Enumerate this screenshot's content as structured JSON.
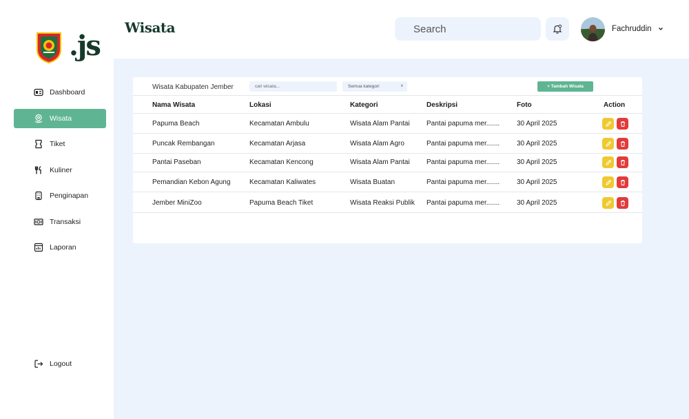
{
  "sidebar": {
    "items": [
      {
        "label": "Dashboard",
        "icon": "dashboard-icon",
        "active": false
      },
      {
        "label": "Wisata",
        "icon": "location-pin-icon",
        "active": true
      },
      {
        "label": "Tiket",
        "icon": "ticket-icon",
        "active": false
      },
      {
        "label": "Kuliner",
        "icon": "utensils-icon",
        "active": false
      },
      {
        "label": "Penginapan",
        "icon": "building-icon",
        "active": false
      },
      {
        "label": "Transaksi",
        "icon": "cash-icon",
        "active": false
      },
      {
        "label": "Laporan",
        "icon": "report-icon",
        "active": false
      }
    ],
    "logout_label": "Logout"
  },
  "header": {
    "title": "Wisata",
    "search_placeholder": "Search",
    "user_name": "Fachruddin"
  },
  "card": {
    "title": "Wisata Kabupaten Jember",
    "search_placeholder": "cari wisata...",
    "category_select": "Semua kategori",
    "category_caret": "v",
    "add_button": "+ Tambah Wisata"
  },
  "table": {
    "headers": [
      "Nama Wisata",
      "Lokasi",
      "Kategori",
      "Deskripsi",
      "Foto",
      "Action"
    ],
    "rows": [
      {
        "nama": "Papuma Beach",
        "lokasi": "Kecamatan Ambulu",
        "kategori": "Wisata Alam Pantai",
        "deskripsi": "Pantai papuma mer.......",
        "foto": "30 April 2025"
      },
      {
        "nama": "Puncak Rembangan",
        "lokasi": "Kecamatan Arjasa",
        "kategori": "Wisata Alam Agro",
        "deskripsi": "Pantai papuma mer.......",
        "foto": "30 April 2025"
      },
      {
        "nama": "Pantai Paseban",
        "lokasi": "Kecamatan Kencong",
        "kategori": "Wisata Alam Pantai",
        "deskripsi": "Pantai papuma mer.......",
        "foto": "30 April 2025"
      },
      {
        "nama": "Pemandian Kebon Agung",
        "lokasi": "Kecamatan Kaliwates",
        "kategori": "Wisata Buatan",
        "deskripsi": "Pantai papuma mer.......",
        "foto": "30 April 2025"
      },
      {
        "nama": "Jember MiniZoo",
        "lokasi": "Papuma Beach Tiket",
        "kategori": "Wisata Reaksi Publik",
        "deskripsi": "Pantai papuma mer.......",
        "foto": "30 April 2025"
      }
    ]
  },
  "colors": {
    "accent": "#5fb593",
    "brand_dark": "#16392b",
    "background": "#edf3fd",
    "edit": "#efc92f",
    "delete": "#e23b3b"
  }
}
